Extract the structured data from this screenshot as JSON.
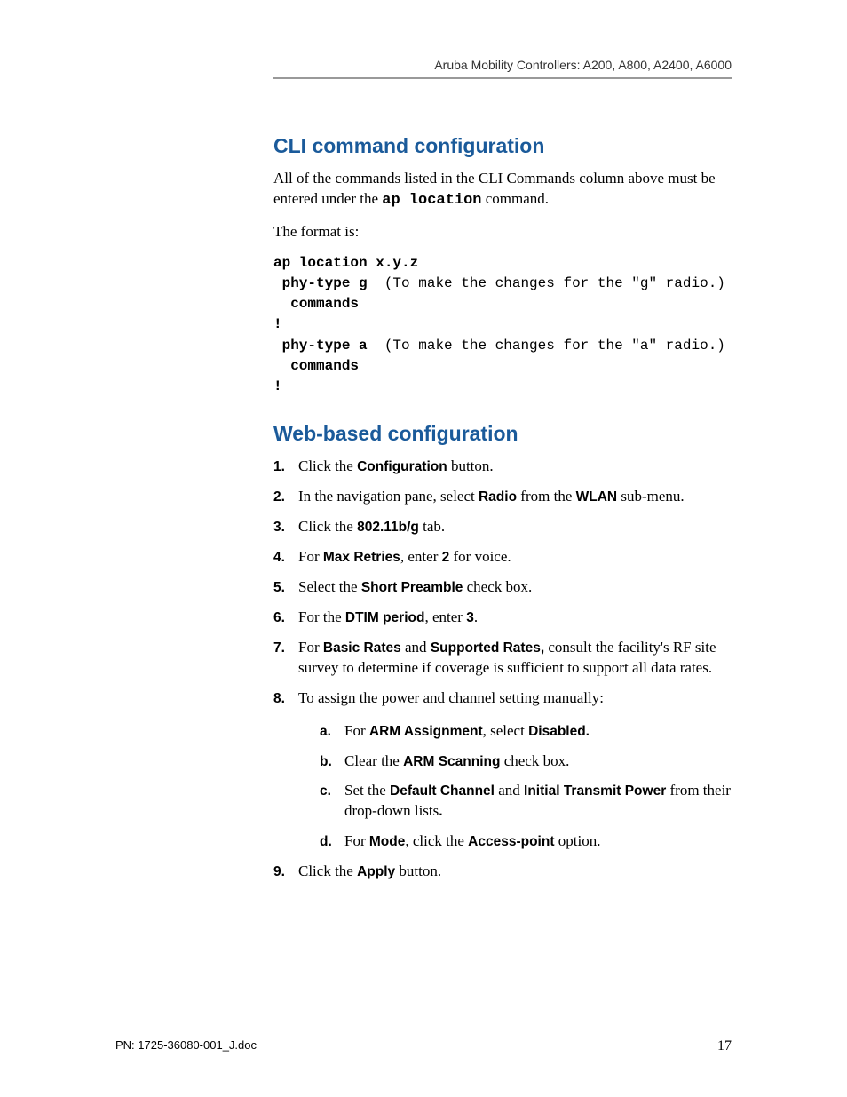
{
  "header": "Aruba Mobility Controllers: A200, A800, A2400, A6000",
  "sections": {
    "cli": {
      "title": "CLI command configuration",
      "intro_pre": "All of the commands listed in the CLI Commands column above must be entered under the ",
      "intro_mono": "ap location",
      "intro_post": " command.",
      "format_label": "The format is:",
      "code_l1": "ap location x.y.z",
      "code_l2a": " phy-type g  ",
      "code_l2b": "(To make the changes for the \"g\" radio.)",
      "code_l3": "  commands",
      "code_l4": "!",
      "code_l5a": " phy-type a  ",
      "code_l5b": "(To make the changes for the \"a\" radio.)",
      "code_l6": "  commands",
      "code_l7": "!"
    },
    "web": {
      "title": "Web-based configuration",
      "steps": {
        "s1_a": "Click the ",
        "s1_b": "Configuration",
        "s1_c": " button.",
        "s2_a": "In the navigation pane, select ",
        "s2_b": "Radio",
        "s2_c": " from the ",
        "s2_d": "WLAN",
        "s2_e": " sub-menu.",
        "s3_a": "Click the ",
        "s3_b": "802.11b/g",
        "s3_c": " tab.",
        "s4_a": "For ",
        "s4_b": "Max Retries",
        "s4_c": ", enter ",
        "s4_d": "2",
        "s4_e": " for voice.",
        "s5_a": "Select the ",
        "s5_b": "Short Preamble",
        "s5_c": " check box.",
        "s6_a": "For the ",
        "s6_b": "DTIM period",
        "s6_c": ", enter ",
        "s6_d": "3",
        "s6_e": ".",
        "s7_a": "For ",
        "s7_b": "Basic Rates",
        "s7_c": " and ",
        "s7_d": "Supported Rates,",
        "s7_e": " consult the facility's RF site survey to determine if coverage is sufficient to support all data rates.",
        "s8_a": "To assign the power and channel setting manually:",
        "s8a_a": "For ",
        "s8a_b": "ARM Assignment",
        "s8a_c": ", select ",
        "s8a_d": "Disabled.",
        "s8b_a": "Clear the ",
        "s8b_b": "ARM Scanning",
        "s8b_c": " check box.",
        "s8c_a": "Set the ",
        "s8c_b": "Default Channel",
        "s8c_c": " and ",
        "s8c_d": "Initial Transmit Power",
        "s8c_e": " from their drop-down lists",
        "s8c_f": ".",
        "s8d_a": "For ",
        "s8d_b": "Mode",
        "s8d_c": ", click the ",
        "s8d_d": "Access-point",
        "s8d_e": " option.",
        "s9_a": "Click the ",
        "s9_b": "Apply",
        "s9_c": " button."
      }
    }
  },
  "footer": {
    "pn": "PN: 1725-36080-001_J.doc",
    "page": "17"
  }
}
